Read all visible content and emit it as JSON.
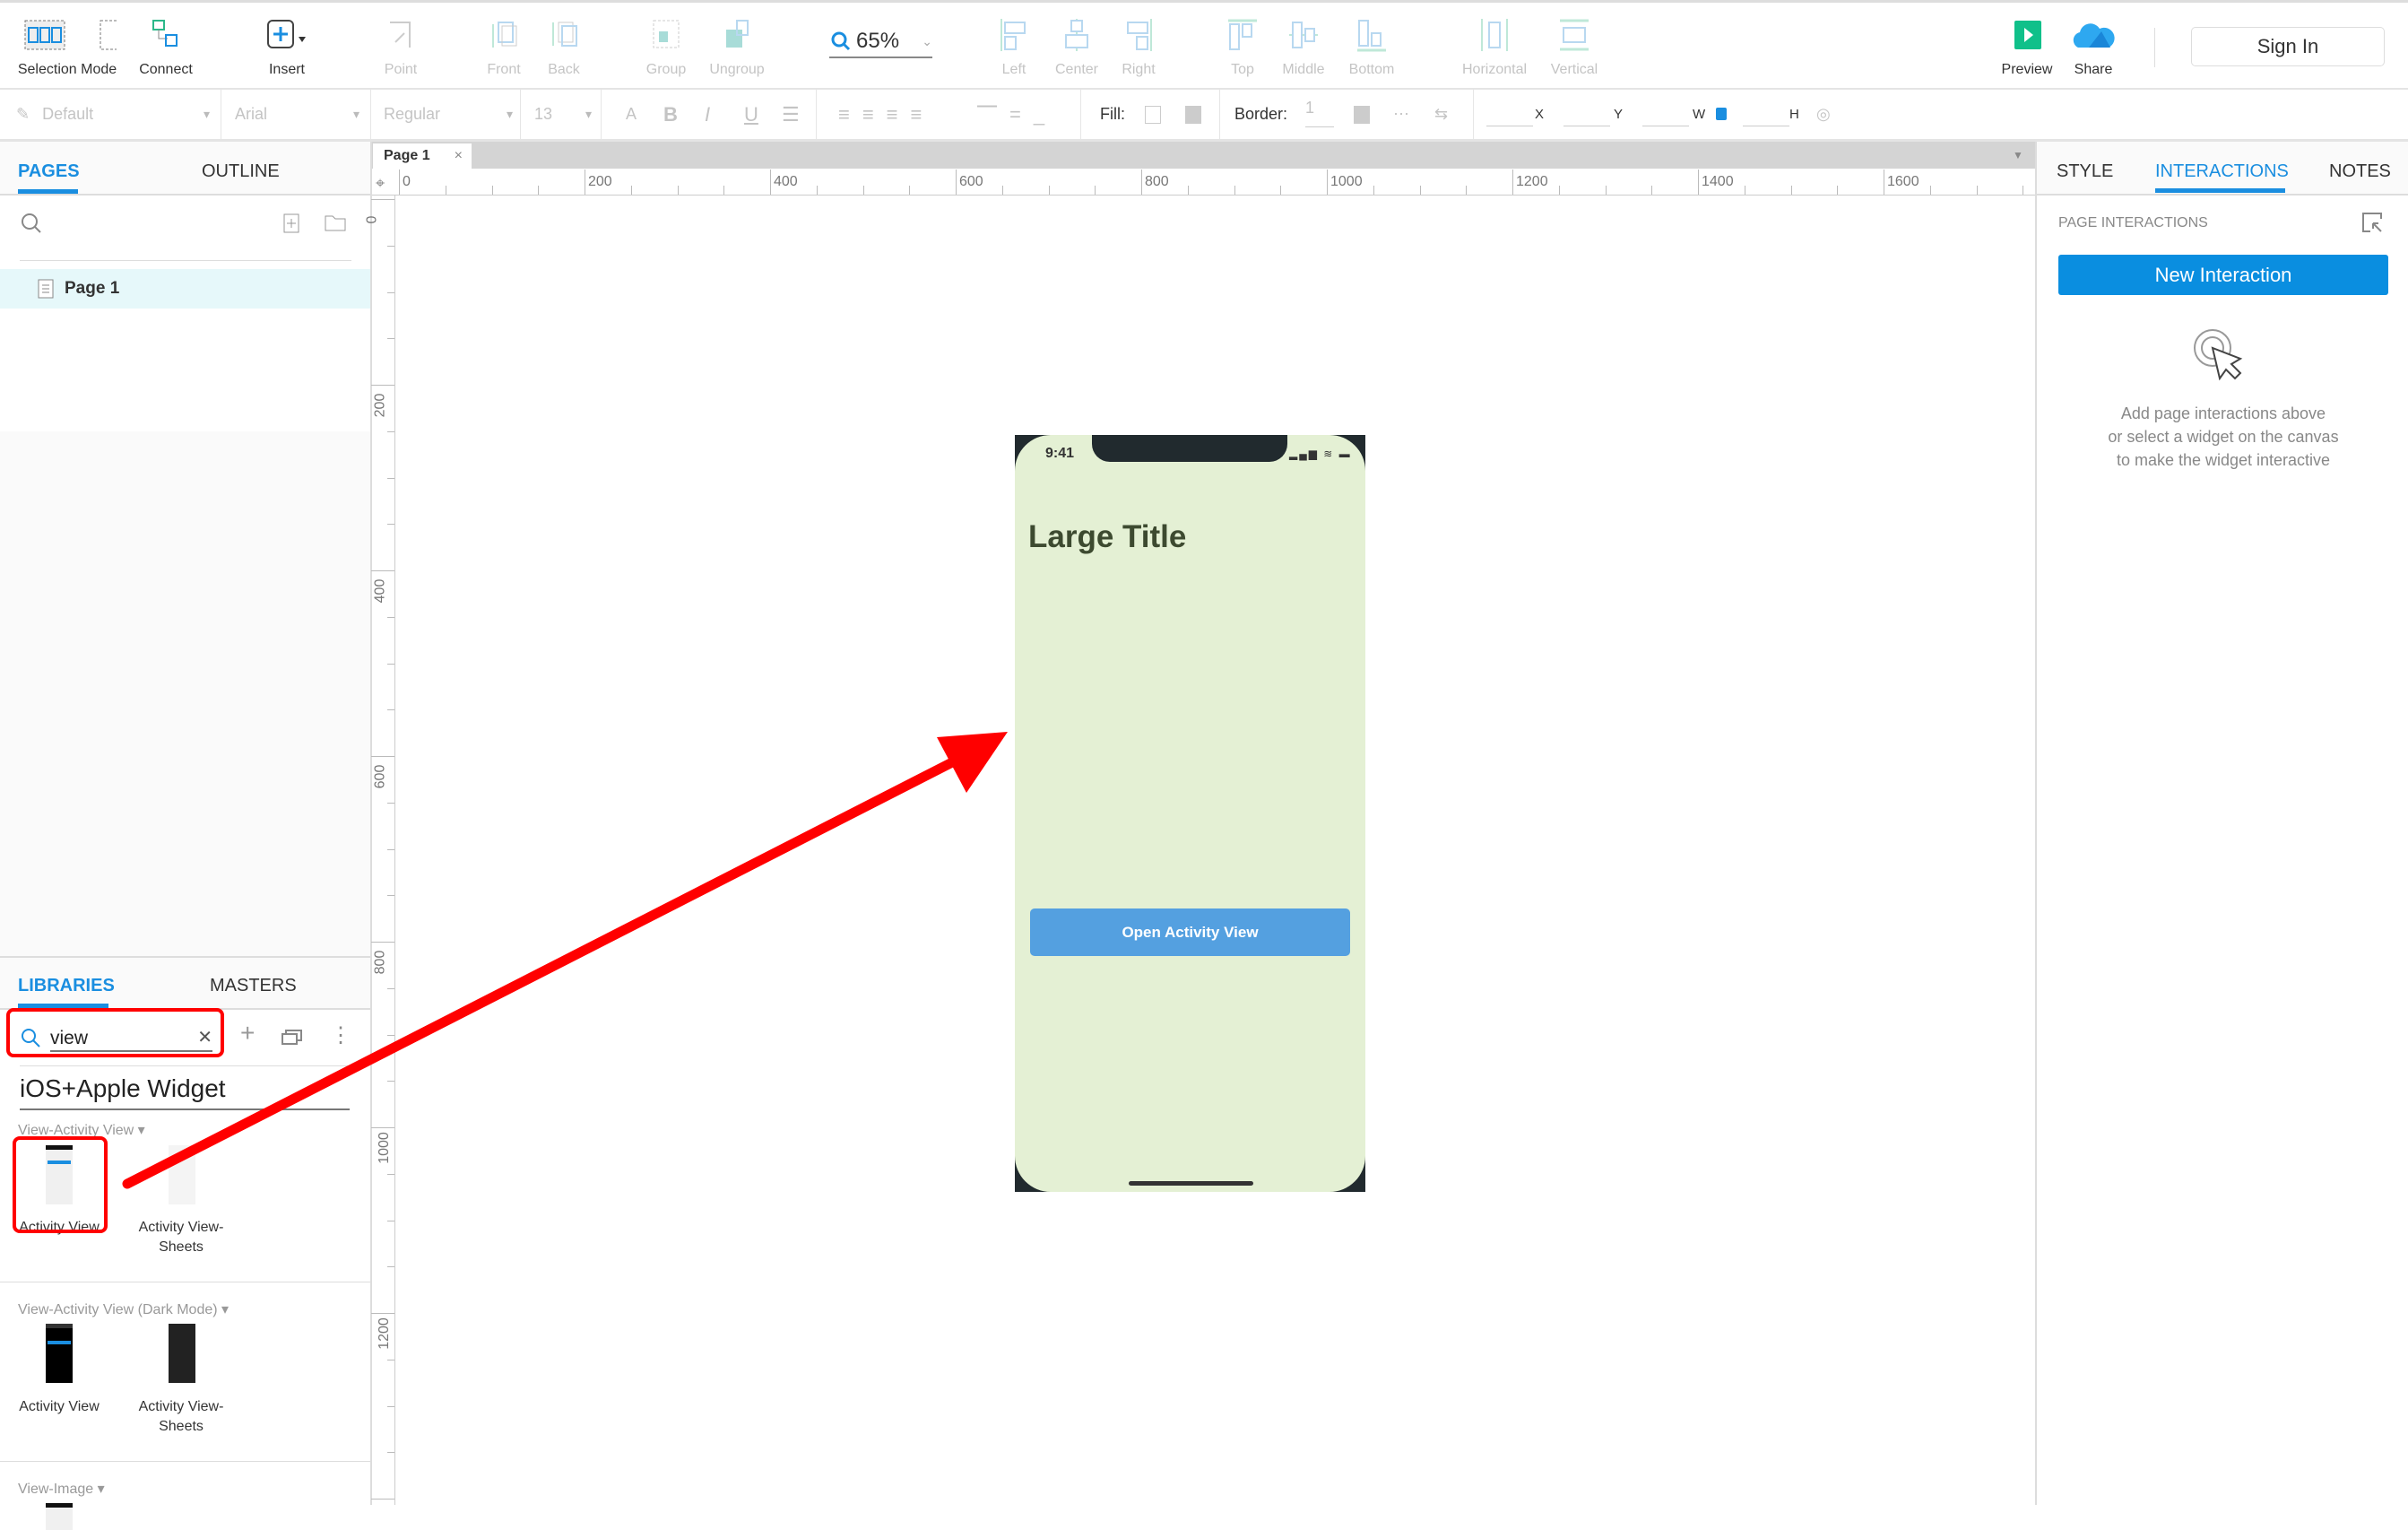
{
  "toolbar": {
    "items": [
      {
        "label": "Selection Mode",
        "enabled": true
      },
      {
        "label": "Connect",
        "enabled": true
      },
      {
        "label": "Insert",
        "enabled": true
      },
      {
        "label": "Point",
        "enabled": false
      },
      {
        "label": "Front",
        "enabled": false
      },
      {
        "label": "Back",
        "enabled": false
      },
      {
        "label": "Group",
        "enabled": false
      },
      {
        "label": "Ungroup",
        "enabled": false
      },
      {
        "label": "Left",
        "enabled": false
      },
      {
        "label": "Center",
        "enabled": false
      },
      {
        "label": "Right",
        "enabled": false
      },
      {
        "label": "Top",
        "enabled": false
      },
      {
        "label": "Middle",
        "enabled": false
      },
      {
        "label": "Bottom",
        "enabled": false
      },
      {
        "label": "Horizontal",
        "enabled": false
      },
      {
        "label": "Vertical",
        "enabled": false
      },
      {
        "label": "Preview",
        "enabled": true
      },
      {
        "label": "Share",
        "enabled": true
      }
    ],
    "zoom": "65%",
    "sign_in": "Sign In"
  },
  "format_bar": {
    "style": "Default",
    "font": "Arial",
    "weight": "Regular",
    "size": "13",
    "fill_label": "Fill:",
    "border_label": "Border:",
    "border_width": "1",
    "x_label": "X",
    "y_label": "Y",
    "w_label": "W",
    "h_label": "H"
  },
  "left_panel": {
    "tabs": [
      "PAGES",
      "OUTLINE"
    ],
    "pages": [
      "Page 1"
    ],
    "lib_tabs": [
      "LIBRARIES",
      "MASTERS"
    ],
    "search_value": "view",
    "library": "iOS+Apple Widget",
    "groups": [
      {
        "title": "View-Activity View ▾",
        "items": [
          "Activity View",
          "Activity View-\nSheets"
        ]
      },
      {
        "title": "View-Activity View (Dark Mode) ▾",
        "items": [
          "Activity View",
          "Activity View-\nSheets"
        ]
      },
      {
        "title": "View-Image ▾",
        "items": []
      }
    ]
  },
  "canvas": {
    "tab": "Page 1",
    "ruler_h": [
      "0",
      "200",
      "400",
      "600",
      "800",
      "1000",
      "1200",
      "1400",
      "1600"
    ],
    "ruler_v": [
      "0",
      "200",
      "400",
      "600",
      "800",
      "1000",
      "1200"
    ],
    "phone": {
      "time": "9:41",
      "title": "Large Title",
      "button": "Open Activity View",
      "bg": "#e4f0d4",
      "button_color": "#54a0e0"
    },
    "annotation_color": "#ff0000"
  },
  "right_panel": {
    "tabs": [
      "STYLE",
      "INTERACTIONS",
      "NOTES"
    ],
    "section": "PAGE INTERACTIONS",
    "new_button": "New Interaction",
    "hint": [
      "Add page interactions above",
      "or select a widget on the canvas",
      "to make the widget interactive"
    ],
    "accent": "#0a8ee0"
  }
}
